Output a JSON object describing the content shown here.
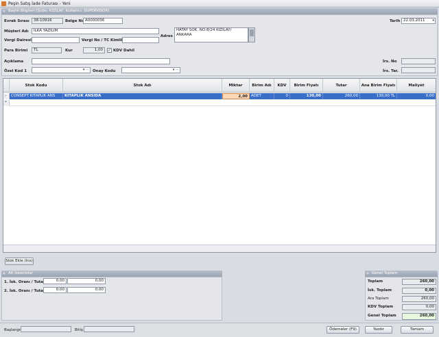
{
  "window": {
    "title": "Peşin Satış İade Faturası - Yeni"
  },
  "header_group": {
    "title": "Başlık Bilgileri [Şube: KIZILAY, Kullanıcı: SUPERVISOR]"
  },
  "form": {
    "evrak_sirasi_label": "Evrak Sırası",
    "evrak_sirasi_value": "38-10916",
    "belge_no_label": "Belge No",
    "belge_no_value": "A0000036",
    "tarih_label": "Tarih",
    "tarih_value": "22.03.2011",
    "musteri_adi_label": "Müşteri Adı",
    "musteri_adi_value": "İLKA YAZILIM",
    "adres_label": "Adres",
    "adres_value": "HATAY SOK. NO:8/24 KIZILAY/ ANKARA",
    "vergi_dairesi_label": "Vergi Dairesi",
    "vergi_dairesi_value": "",
    "vergi_no_label": "Vergi No / TC Kimlik",
    "vergi_no_value": "",
    "para_birimi_label": "Para Birimi",
    "para_birimi_value": "TL",
    "kur_label": "Kur",
    "kur_value": "1,00",
    "kdv_dahil_label": "KDV Dahil",
    "kdv_dahil_check": "✓",
    "aciklama_label": "Açıklama",
    "aciklama_value": "",
    "irs_no_label": "İrs. No",
    "irs_no_value": "",
    "ozel_kod_label": "Özel Kod 1",
    "ozel_kod_value": "",
    "onay_kodu_label": "Onay Kodu",
    "onay_kodu_value": "",
    "irs_tar_label": "İrs. Tar.",
    "irs_tar_value": ""
  },
  "grid": {
    "columns": [
      "Stok Kodu",
      "Stok Adı",
      "Miktar",
      "Birim Adı",
      "KDV",
      "Birim Fiyatı",
      "Tutar",
      "Ana Birim Fiyatı",
      "Maliyet"
    ],
    "rows": [
      {
        "stok_kodu": "CONSEPT KITAPLIK ANS",
        "stok_adi": "KITAPLIK ANSIDA",
        "miktar": "2,00",
        "birim_adi": "ADET",
        "kdv": "0",
        "birim_fiyati": "130,00",
        "tutar": "260,00",
        "ana_birim_fiyati": "130,00 TL",
        "maliyet": "0,00"
      }
    ],
    "current_row_marker": "›",
    "new_row_marker": "*"
  },
  "buttons": {
    "stok_ekle": "Stok Ekle (Ins)",
    "odemeler": "Ödemeler (F9)",
    "yazdir": "Yazdır",
    "tamam": "Tamam"
  },
  "alt_iskontolar": {
    "title": "Alt İskontolar",
    "row1_label": "1. İsk. Oranı / Tutarı",
    "row1_oran": "0,00",
    "row1_tutar": "0,00",
    "row2_label": "2. İsk. Oranı / Tutarı",
    "row2_oran": "0,00",
    "row2_tutar": "0,00"
  },
  "genel_toplam": {
    "title": "Genel Toplam",
    "toplam_label": "Toplam",
    "toplam_value": "260,00",
    "isk_toplam_label": "İsk. Toplam",
    "isk_toplam_value": "0,00",
    "ara_toplam_label": "Ara Toplam",
    "ara_toplam_value": "260,00",
    "kdv_toplam_label": "KDV Toplam",
    "kdv_toplam_value": "0,00",
    "genel_toplam_label": "Genel Toplam",
    "genel_toplam_value": "260,00"
  },
  "footer": {
    "baslangic_label": "Başlangıç",
    "baslangic_value": "",
    "bitis_label": "Bitiş",
    "bitis_value": ""
  }
}
